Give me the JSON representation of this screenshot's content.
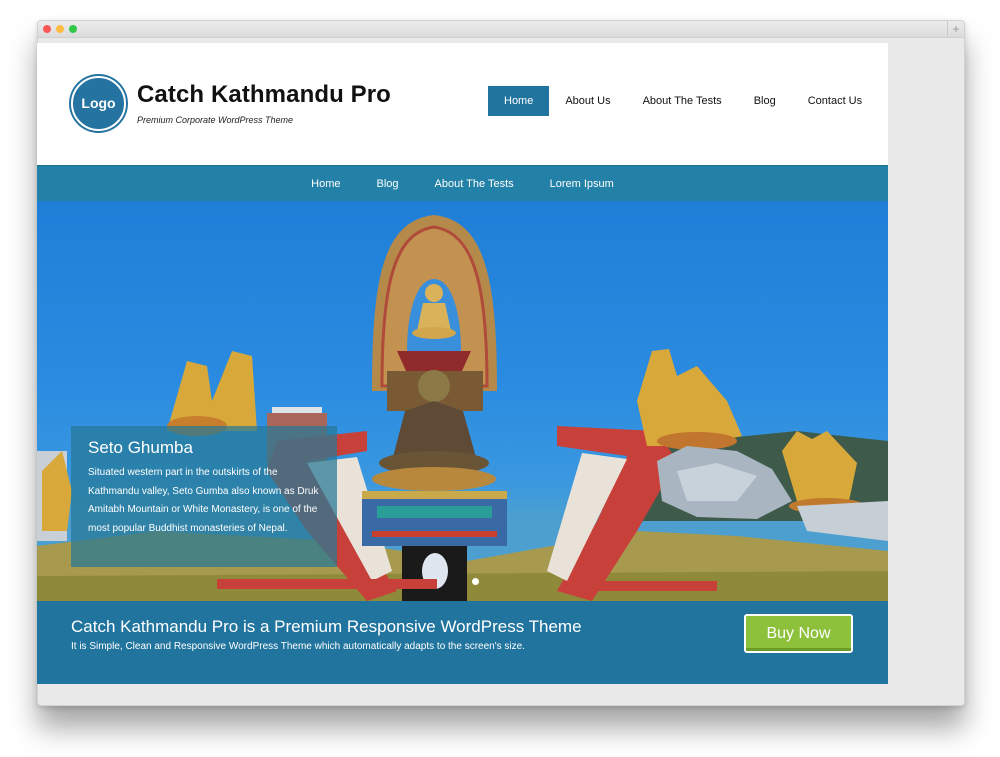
{
  "browser": {
    "traffic_lights": [
      "close",
      "minimize",
      "maximize"
    ],
    "new_tab_label": "+"
  },
  "header": {
    "logo_text": "Logo",
    "site_title": "Catch Kathmandu Pro",
    "site_description": "Premium Corporate WordPress Theme",
    "primary_nav": [
      {
        "label": "Home",
        "active": true
      },
      {
        "label": "About Us",
        "active": false
      },
      {
        "label": "About The Tests",
        "active": false
      },
      {
        "label": "Blog",
        "active": false
      },
      {
        "label": "Contact Us",
        "active": false
      }
    ]
  },
  "secondary_nav": [
    {
      "label": "Home"
    },
    {
      "label": "Blog"
    },
    {
      "label": "About The Tests"
    },
    {
      "label": "Lorem Ipsum"
    }
  ],
  "slider": {
    "image_description": "Golden Buddhist statues at Seto Gumba monastery against a blue sky",
    "caption_title": "Seto Ghumba",
    "caption_text": "Situated western part in the outskirts of the Kathmandu valley, Seto Gumba also known as Druk Amitabh Mountain or White Monastery, is one of the most popular Buddhist monasteries of Nepal.",
    "pagination": {
      "total": 1,
      "active": 1
    }
  },
  "promotion": {
    "headline": "Catch Kathmandu Pro is a Premium Responsive WordPress Theme",
    "subtext": "It is Simple, Clean and Responsive WordPress Theme which automatically adapts to the screen's size.",
    "button_label": "Buy Now"
  },
  "colors": {
    "primary_blue": "#21749e",
    "nav_blue": "#2380a6",
    "buy_green": "#8dc03b"
  }
}
